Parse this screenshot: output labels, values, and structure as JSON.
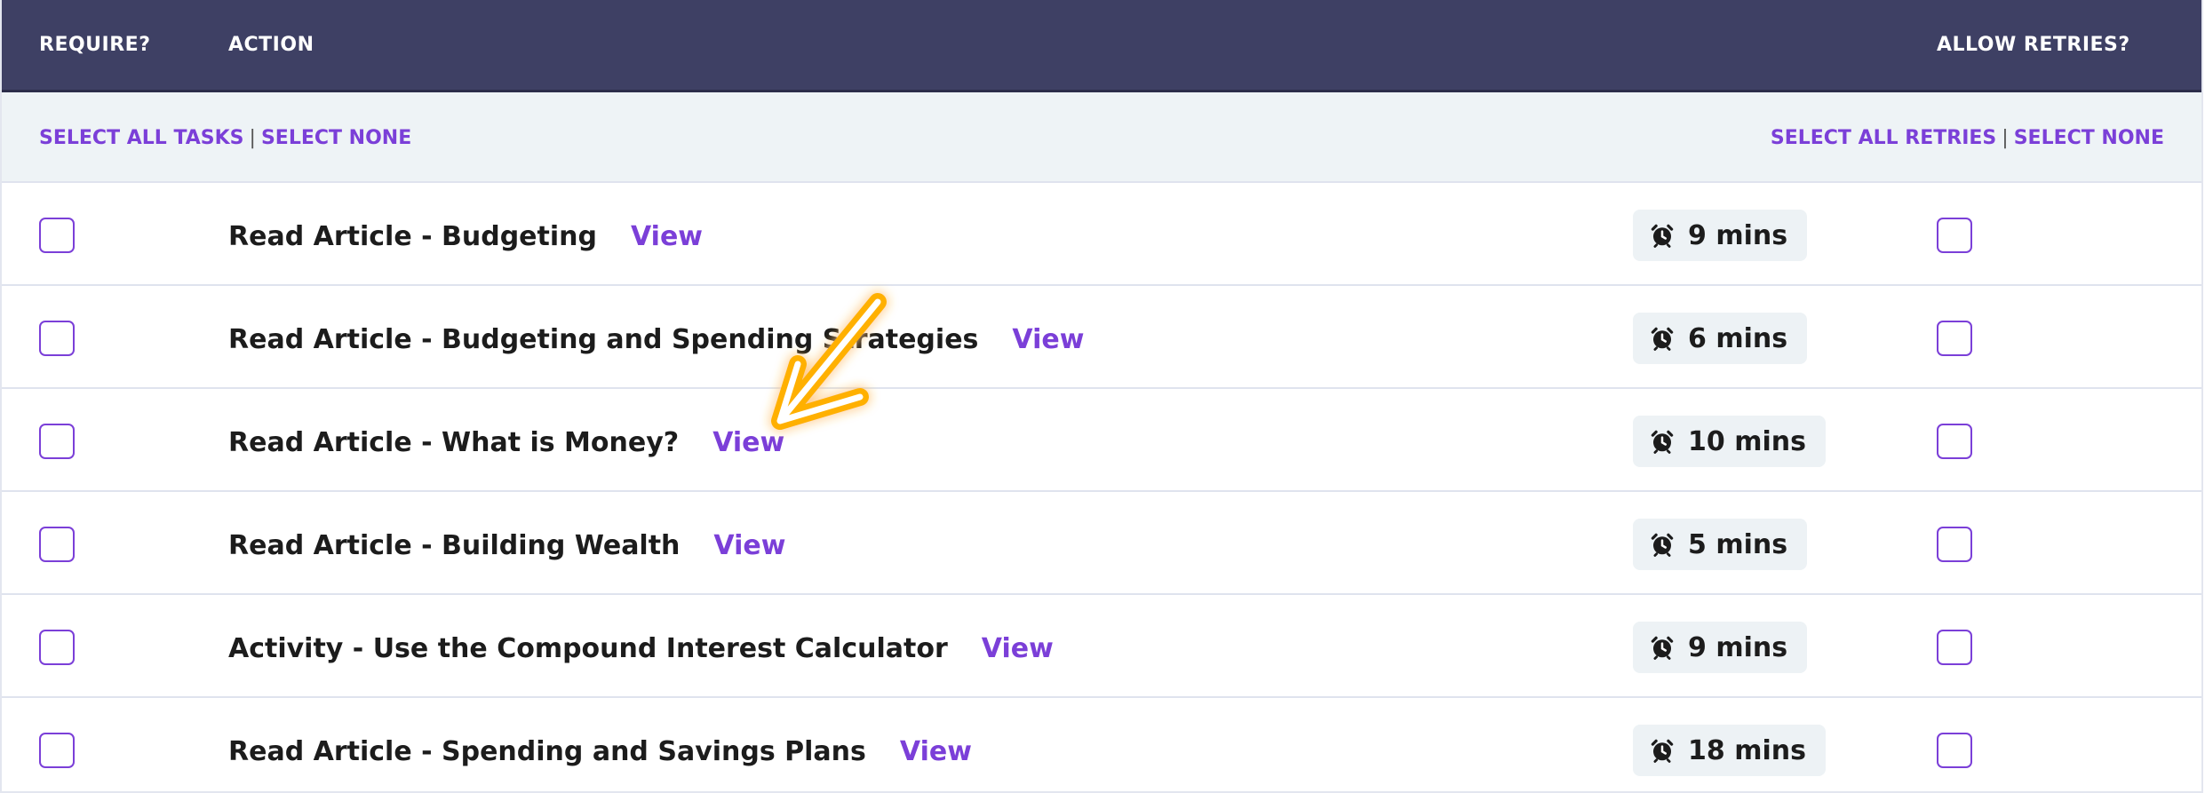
{
  "header": {
    "require": "REQUIRE?",
    "action": "ACTION",
    "allow_retries": "ALLOW RETRIES?"
  },
  "toolbar": {
    "select_all_tasks": "SELECT ALL TASKS",
    "select_none_tasks": "SELECT NONE",
    "separator": "|",
    "select_all_retries": "SELECT ALL RETRIES",
    "select_none_retries": "SELECT NONE"
  },
  "colors": {
    "header_bg": "#3e4064",
    "accent": "#7b3fd8",
    "toolbar_bg": "#eef3f6",
    "duration_bg": "#edf2f5",
    "annotation_arrow": "#ffb000"
  },
  "icons": {
    "duration": "alarm-clock-icon",
    "annotation": "arrow-pointer-icon"
  },
  "tasks": [
    {
      "title": "Read Article - Budgeting",
      "view": "View",
      "duration": "9 mins"
    },
    {
      "title": "Read Article - Budgeting and Spending Strategies",
      "view": "View",
      "duration": "6 mins"
    },
    {
      "title": "Read Article - What is Money?",
      "view": "View",
      "duration": "10 mins"
    },
    {
      "title": "Read Article - Building Wealth",
      "view": "View",
      "duration": "5 mins"
    },
    {
      "title": "Activity - Use the Compound Interest Calculator",
      "view": "View",
      "duration": "9 mins"
    },
    {
      "title": "Read Article - Spending and Savings Plans",
      "view": "View",
      "duration": "18 mins"
    }
  ]
}
